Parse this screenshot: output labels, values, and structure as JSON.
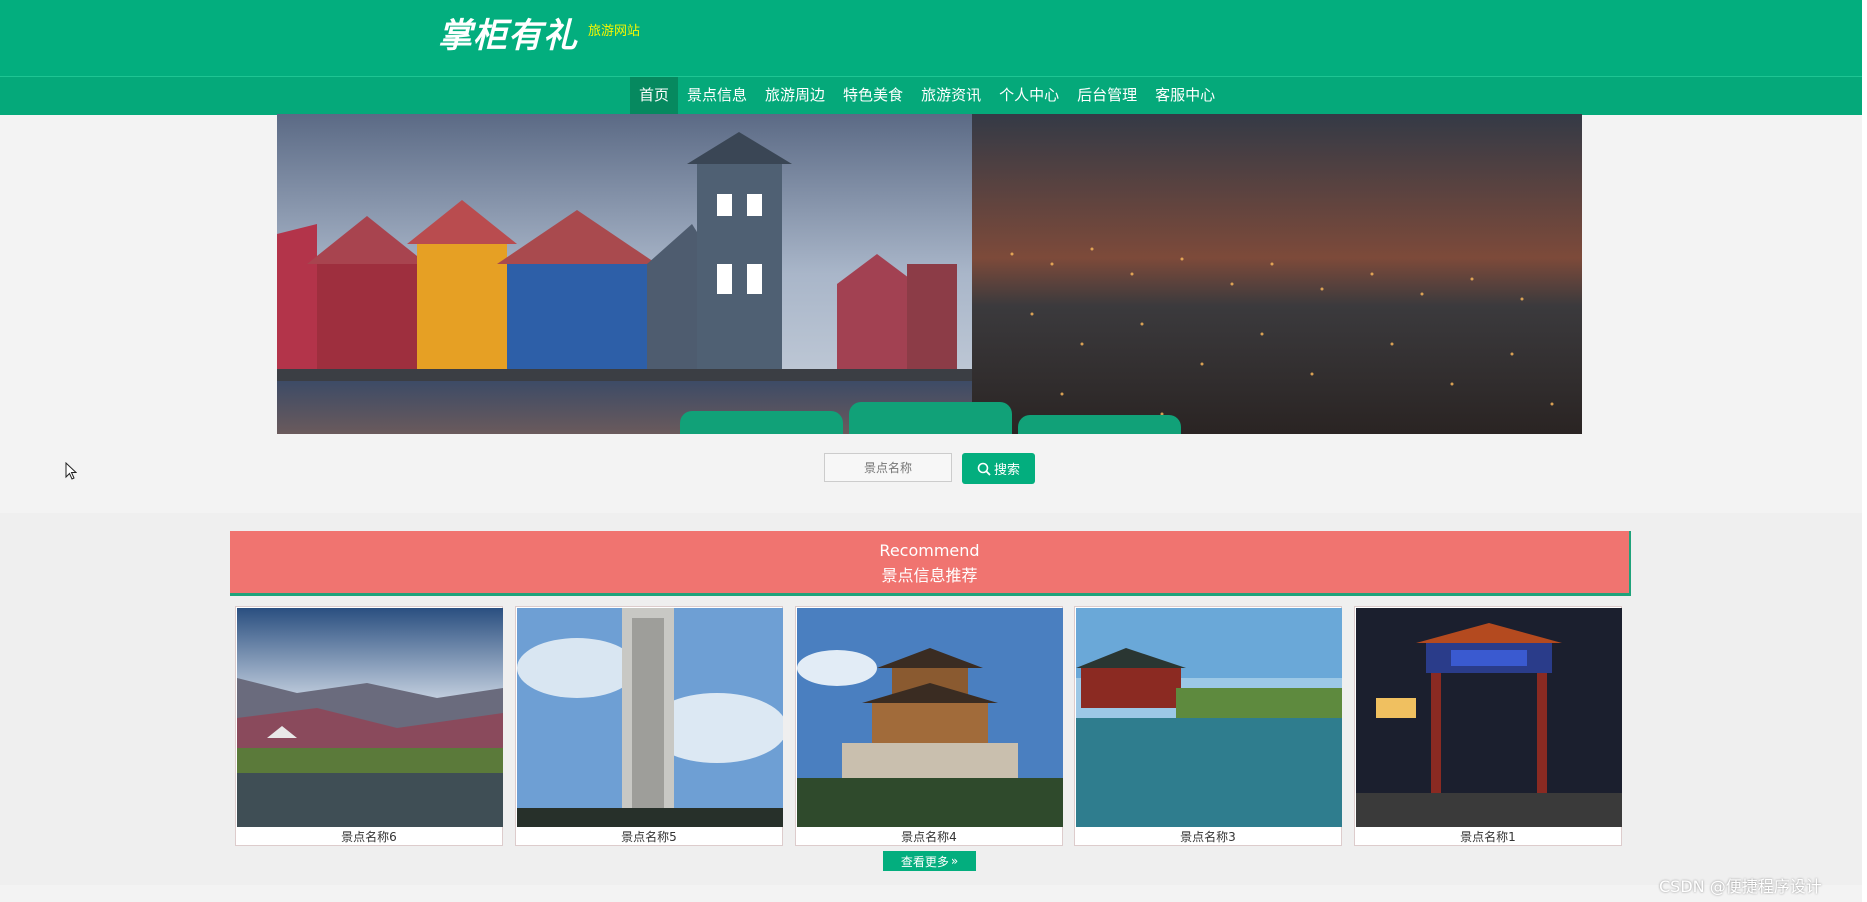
{
  "header": {
    "logo_text": "掌柜有礼",
    "subtitle": "旅游网站",
    "bg_color": "#03ae7e",
    "subtitle_color": "#f6f600"
  },
  "nav": {
    "items": [
      {
        "label": "首页",
        "active": true
      },
      {
        "label": "景点信息"
      },
      {
        "label": "旅游周边"
      },
      {
        "label": "特色美食"
      },
      {
        "label": "旅游资讯"
      },
      {
        "label": "个人中心"
      },
      {
        "label": "后台管理"
      },
      {
        "label": "客服中心"
      }
    ]
  },
  "search": {
    "placeholder": "景点名称",
    "button_label": "搜索",
    "button_icon": "search-icon"
  },
  "recommend": {
    "title_en": "Recommend",
    "title_cn": "景点信息推荐",
    "banner_color": "#f07470"
  },
  "cards": [
    {
      "label": "景点名称6"
    },
    {
      "label": "景点名称5"
    },
    {
      "label": "景点名称4"
    },
    {
      "label": "景点名称3"
    },
    {
      "label": "景点名称1"
    }
  ],
  "more": {
    "label": "查看更多",
    "icon": "double-chevron-right-icon"
  },
  "watermark": "CSDN @便捷程序设计"
}
